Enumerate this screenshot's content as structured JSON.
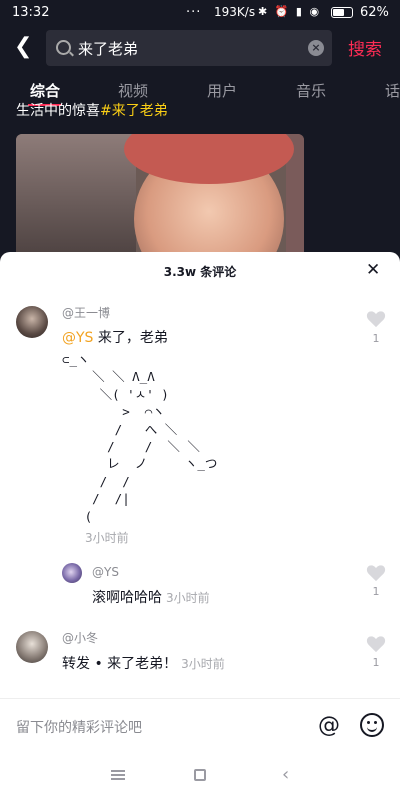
{
  "status_bar": {
    "time": "13:32",
    "dots": "···",
    "network_speed": "193K/s",
    "icons_text": "✱ ⏰ ▮ ◉",
    "battery_percent": "62%",
    "battery_level": 0.62
  },
  "search": {
    "query": "来了老弟",
    "button_label": "搜索"
  },
  "tabs": [
    {
      "label": "综合"
    },
    {
      "label": "视频"
    },
    {
      "label": "用户"
    },
    {
      "label": "音乐"
    },
    {
      "label": "话"
    }
  ],
  "video": {
    "caption_prefix": "生活中的惊喜",
    "caption_tag": "#来了老弟"
  },
  "comments_sheet": {
    "title": "3.3w 条评论",
    "comments": [
      {
        "username": "@王一博",
        "mention": "@YS",
        "text": " 来了，老弟",
        "ascii_art": "⊂_ヽ\n    ＼ ＼ Λ_Λ\n     ＼( 'ㅅ' )\n        >  ⌒ヽ\n       /   へ ＼\n      /    /  ＼ ＼\n      レ  ノ     ヽ_つ\n     /  /\n    /  /|\n   (",
        "time": "3小时前",
        "likes": "1"
      },
      {
        "username": "@YS",
        "text": "滚啊哈哈哈",
        "time": "3小时前",
        "likes": "1"
      },
      {
        "username": "@小冬",
        "text": "转发 • 来了老弟！",
        "time": "3小时前",
        "likes": "1"
      }
    ]
  },
  "input_bar": {
    "placeholder": "留下你的精彩评论吧",
    "at_symbol": "@"
  },
  "nav_bar": {
    "back_glyph": "‹"
  }
}
